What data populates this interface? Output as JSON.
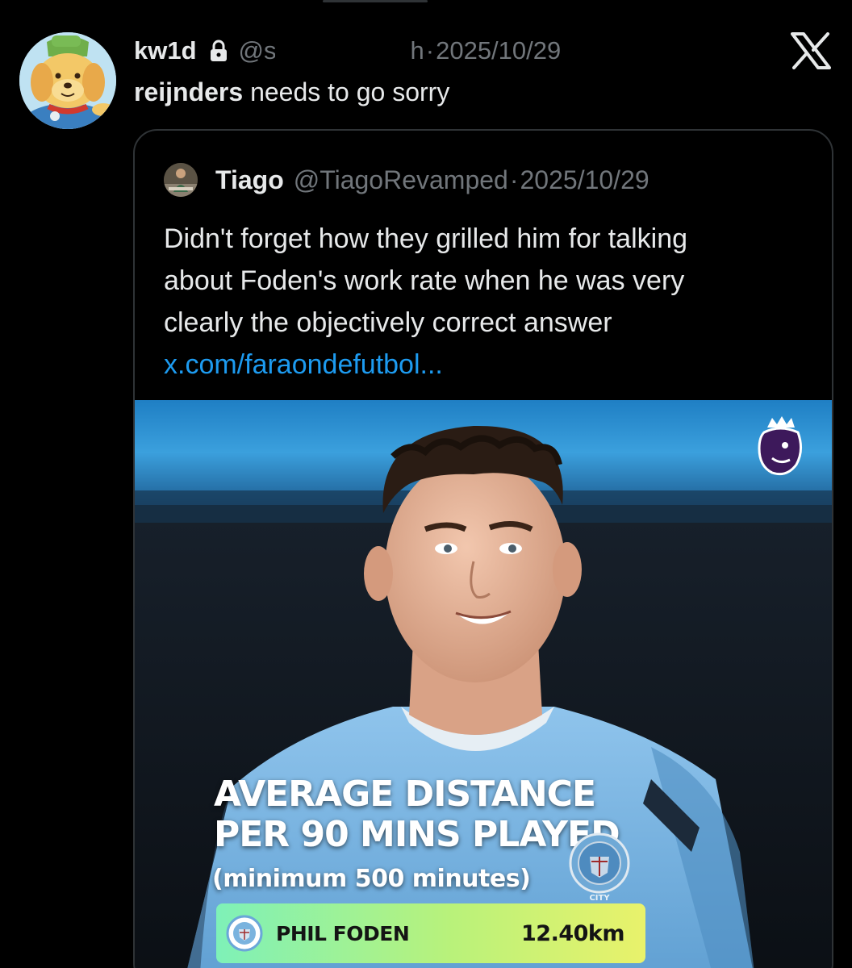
{
  "tweet": {
    "author_name": "kw1d",
    "handle_partial": "@s",
    "handle_tail": "h",
    "separator": "·",
    "date": "2025/10/29",
    "text_bold": "reijnders",
    "text_rest": " needs to go sorry"
  },
  "quoted": {
    "author_name": "Tiago",
    "handle": "@TiagoRevamped",
    "separator": "·",
    "date": "2025/10/29",
    "text_lines": [
      "Didn't forget how they grilled him for talking",
      "about Foden's work rate when he was very",
      "clearly the objectively correct answer"
    ],
    "link": "x.com/faraondefutbol..."
  },
  "media": {
    "headline_lines": [
      "AVERAGE DISTANCE",
      "PER 90 MINS PLAYED"
    ],
    "subline": "(minimum 500 minutes)",
    "crest_text": "CITY",
    "stat": {
      "player": "PHIL FODEN",
      "value": "12.40km"
    }
  },
  "icons": {
    "lock": "lock-icon",
    "x_logo": "x-logo-icon",
    "premier_league": "premier-league-lion-icon",
    "club_crest": "manchester-city-crest-icon"
  },
  "colors": {
    "background": "#000000",
    "text_primary": "#e7e9ea",
    "text_secondary": "#71767b",
    "link": "#1d9bf0",
    "card_border": "#2f3336",
    "stat_gradient_start": "#7ef1b8",
    "stat_gradient_end": "#e9f26b"
  }
}
